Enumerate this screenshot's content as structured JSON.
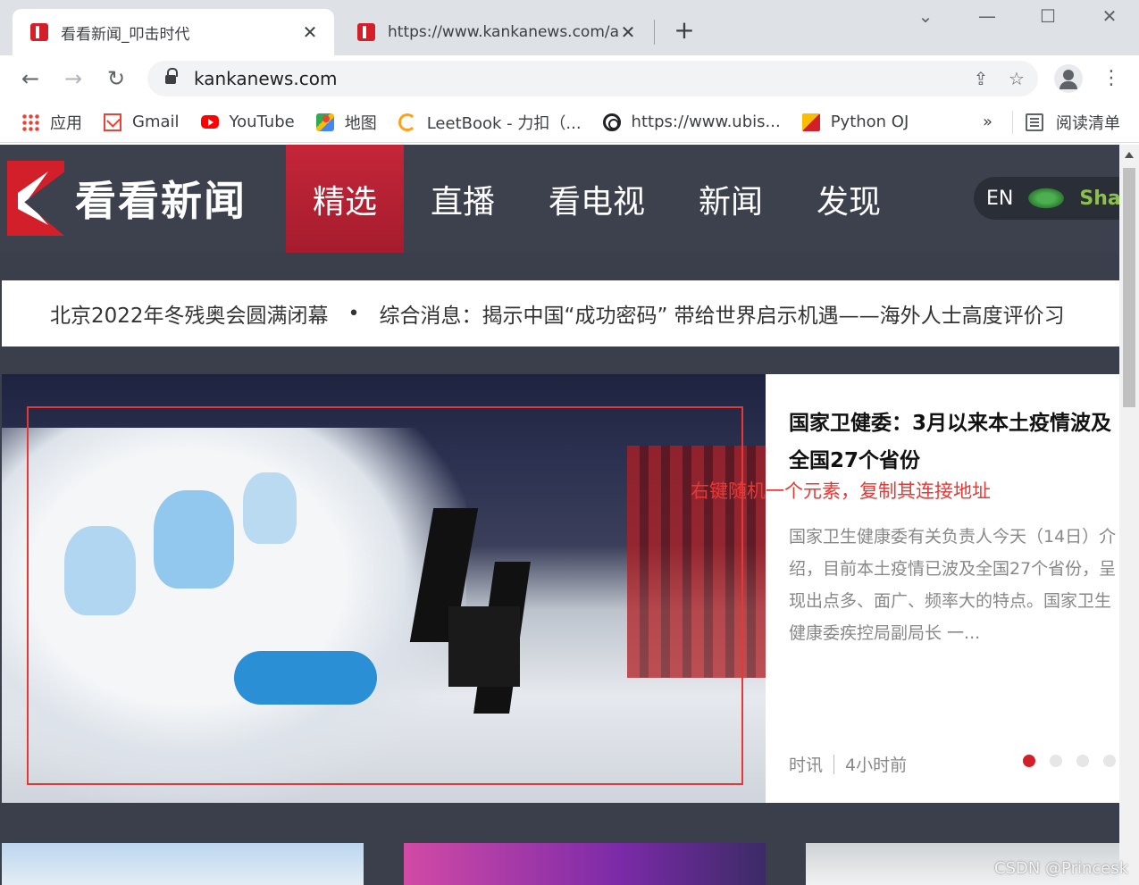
{
  "browser": {
    "tabs": [
      {
        "title": "看看新闻_叩击时代",
        "active": true
      },
      {
        "title": "https://www.kankanews.com/a",
        "active": false
      }
    ],
    "url": "kankanews.com",
    "bookmarks": [
      {
        "label": "应用",
        "icon": "apps-icon"
      },
      {
        "label": "Gmail",
        "icon": "gmail-icon"
      },
      {
        "label": "YouTube",
        "icon": "youtube-icon"
      },
      {
        "label": "地图",
        "icon": "maps-icon"
      },
      {
        "label": "LeetBook - 力扣（...",
        "icon": "leetcode-icon"
      },
      {
        "label": "https://www.ubis...",
        "icon": "ubisoft-icon"
      },
      {
        "label": "Python OJ",
        "icon": "python-oj-icon"
      }
    ],
    "more_label": "»",
    "reading_list": "阅读清单"
  },
  "site": {
    "logo_text": "看看新闻",
    "nav": [
      {
        "label": "精选",
        "active": true
      },
      {
        "label": "直播",
        "active": false
      },
      {
        "label": "看电视",
        "active": false
      },
      {
        "label": "新闻",
        "active": false
      },
      {
        "label": "发现",
        "active": false
      }
    ],
    "lang": {
      "en": "EN",
      "brand": "Shan"
    },
    "ticker": [
      "北京2022年冬残奥会圆满闭幕",
      "综合消息：揭示中国“成功密码” 带给世界启示机遇——海外人士高度评价习"
    ],
    "feature": {
      "title": "国家卫健委：3月以来本土疫情波及全国27个省份",
      "summary": "国家卫生健康委有关负责人今天（14日）介绍，目前本土疫情已波及全国27个省份，呈现出点多、面广、频率大的特点。国家卫生健康委疾控局副局长 一...",
      "category": "时讯",
      "time": "4小时前",
      "carousel": {
        "count": 4,
        "active_index": 0
      }
    }
  },
  "annotation": "右键随机一个元素，复制其连接地址",
  "watermark": "CSDN @Princesk",
  "colors": {
    "brand_red": "#d31f2a",
    "header_bg": "#3c414d",
    "annotation_red": "#e53935"
  }
}
